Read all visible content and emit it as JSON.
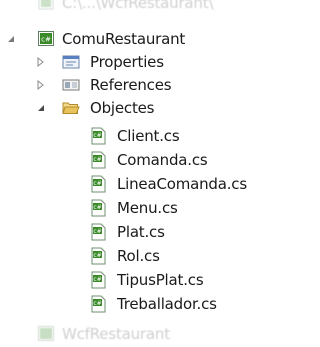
{
  "solution_tree": {
    "top_partial": {
      "label": "C:\\...\\WcfRestaurant\\"
    },
    "project": {
      "label": "ComuRestaurant",
      "icon": "csharp-project-icon",
      "expanded": true
    },
    "children": [
      {
        "label": "Properties",
        "icon": "properties-icon",
        "expanded": false
      },
      {
        "label": "References",
        "icon": "references-icon",
        "expanded": false
      },
      {
        "label": "Objectes",
        "icon": "folder-open-icon",
        "expanded": true
      }
    ],
    "files": [
      {
        "label": "Client.cs",
        "icon": "csharp-file-icon"
      },
      {
        "label": "Comanda.cs",
        "icon": "csharp-file-icon"
      },
      {
        "label": "LineaComanda.cs",
        "icon": "csharp-file-icon"
      },
      {
        "label": "Menu.cs",
        "icon": "csharp-file-icon"
      },
      {
        "label": "Plat.cs",
        "icon": "csharp-file-icon"
      },
      {
        "label": "Rol.cs",
        "icon": "csharp-file-icon"
      },
      {
        "label": "TipusPlat.cs",
        "icon": "csharp-file-icon"
      },
      {
        "label": "Treballador.cs",
        "icon": "csharp-file-icon"
      }
    ],
    "bottom_partial": {
      "label": "WcfRestaurant",
      "icon": "csharp-project-icon"
    }
  },
  "colors": {
    "csharp_green": "#3a8a2a",
    "folder_yellow": "#e8c25a",
    "expander": "#6b6b6b"
  }
}
